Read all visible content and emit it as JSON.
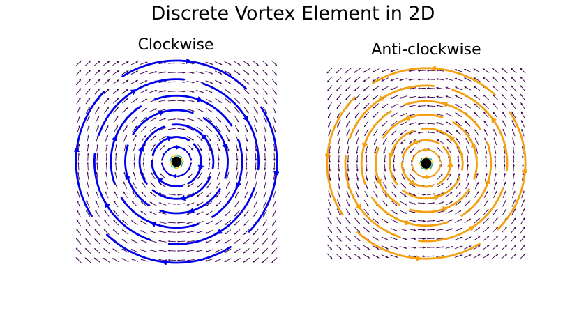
{
  "figure": {
    "title": "Discrete Vortex Element in 2D"
  },
  "colors": {
    "field_arrows": "#3b0050",
    "clockwise_stream": "#0000ee",
    "anticlockwise_stream": "#f5a00f",
    "center": "#000000",
    "inner_yellow": "#ffd400",
    "inner_teal": "#1fb0a0"
  },
  "chart_data": [
    {
      "type": "quiver+streamplot",
      "title": "Clockwise",
      "direction": "clockwise",
      "xlim": [
        -1,
        1
      ],
      "ylim": [
        -1,
        1
      ],
      "vortex_center": [
        0,
        0
      ],
      "grid_points_per_axis": 22,
      "streamline_radii": [
        0.14,
        0.24,
        0.36,
        0.5,
        0.64,
        0.8,
        0.98
      ],
      "axes_visible": false,
      "grid": false
    },
    {
      "type": "quiver+streamplot",
      "title": "Anti-clockwise",
      "direction": "anticlockwise",
      "xlim": [
        -1,
        1
      ],
      "ylim": [
        -1,
        1
      ],
      "vortex_center": [
        0,
        0
      ],
      "grid_points_per_axis": 22,
      "streamline_radii": [
        0.14,
        0.24,
        0.36,
        0.5,
        0.64,
        0.8,
        0.98
      ],
      "axes_visible": false,
      "grid": false
    }
  ]
}
